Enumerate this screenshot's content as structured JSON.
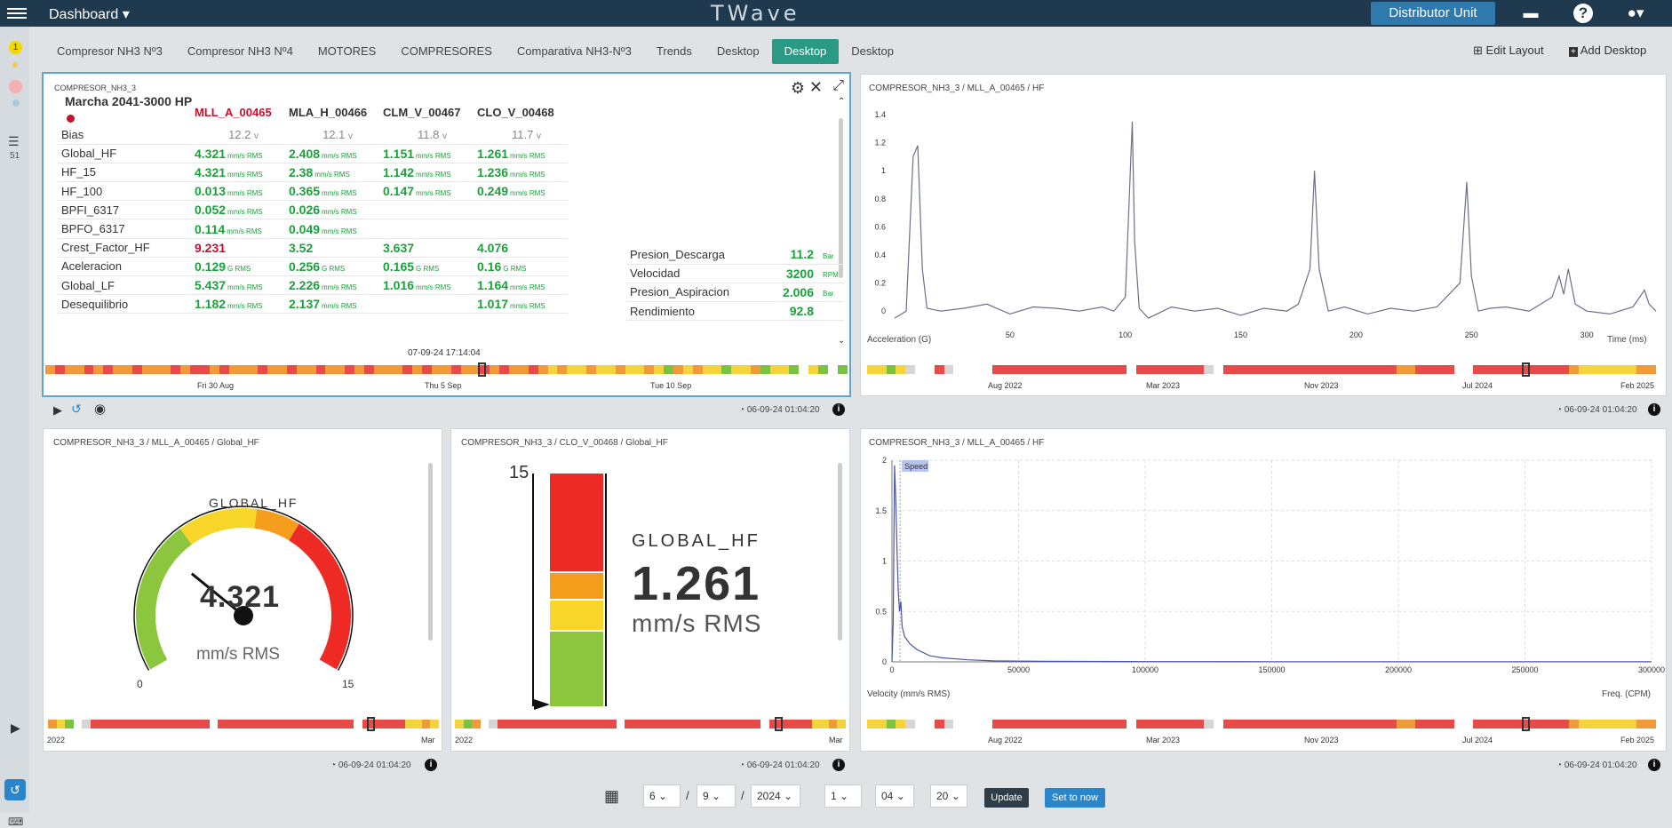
{
  "topbar": {
    "menu": "Dashboard",
    "logo": "TWave",
    "distributor": "Distributor Unit",
    "icons": [
      "chat-icon",
      "help-icon",
      "user-icon"
    ]
  },
  "rail": {
    "badge": "1",
    "count": "51"
  },
  "tabs": [
    {
      "label": "Compresor NH3 Nº3",
      "active": false
    },
    {
      "label": "Compresor NH3 Nº4",
      "active": false
    },
    {
      "label": "MOTORES",
      "active": false
    },
    {
      "label": "COMPRESORES",
      "active": false
    },
    {
      "label": "Comparativa NH3-Nº3",
      "active": false
    },
    {
      "label": "Trends",
      "active": false
    },
    {
      "label": "Desktop",
      "active": false
    },
    {
      "label": "Desktop",
      "active": true
    },
    {
      "label": "Desktop",
      "active": false
    }
  ],
  "actions": {
    "edit_layout": "Edit Layout",
    "add_desktop": "Add Desktop"
  },
  "table_panel": {
    "title": "COMPRESOR_NH3_3",
    "machine": "Marcha 2041-3000 HP",
    "columns": [
      "MLL_A_00465",
      "MLA_H_00466",
      "CLM_V_00467",
      "CLO_V_00468"
    ],
    "bias": {
      "label": "Bias",
      "values": [
        "12.2",
        "12.1",
        "11.8",
        "11.7"
      ],
      "unit": "v"
    },
    "rows": [
      {
        "label": "Global_HF",
        "cells": [
          [
            "4.321",
            "mm/s RMS"
          ],
          [
            "2.408",
            "mm/s RMS"
          ],
          [
            "1.151",
            "mm/s RMS"
          ],
          [
            "1.261",
            "mm/s RMS"
          ]
        ]
      },
      {
        "label": "HF_15",
        "cells": [
          [
            "4.321",
            "mm/s RMS"
          ],
          [
            "2.38",
            "mm/s RMS"
          ],
          [
            "1.142",
            "mm/s RMS"
          ],
          [
            "1.236",
            "mm/s RMS"
          ]
        ]
      },
      {
        "label": "HF_100",
        "cells": [
          [
            "0.013",
            "mm/s RMS"
          ],
          [
            "0.365",
            "mm/s RMS"
          ],
          [
            "0.147",
            "mm/s RMS"
          ],
          [
            "0.249",
            "mm/s RMS"
          ]
        ]
      },
      {
        "label": "BPFI_6317",
        "cells": [
          [
            "0.052",
            "mm/s RMS"
          ],
          [
            "0.026",
            "mm/s RMS"
          ],
          [
            "",
            ""
          ],
          [
            "",
            ""
          ]
        ]
      },
      {
        "label": "BPFO_6317",
        "cells": [
          [
            "0.114",
            "mm/s RMS"
          ],
          [
            "0.049",
            "mm/s RMS"
          ],
          [
            "",
            ""
          ],
          [
            "",
            ""
          ]
        ]
      },
      {
        "label": "Crest_Factor_HF",
        "cells": [
          [
            "9.231",
            ""
          ],
          [
            "3.52",
            ""
          ],
          [
            "3.637",
            ""
          ],
          [
            "4.076",
            ""
          ]
        ]
      },
      {
        "label": "Aceleracion",
        "cells": [
          [
            "0.129",
            "G RMS"
          ],
          [
            "0.256",
            "G RMS"
          ],
          [
            "0.165",
            "G RMS"
          ],
          [
            "0.16",
            "G RMS"
          ]
        ]
      },
      {
        "label": "Global_LF",
        "cells": [
          [
            "5.437",
            "mm/s RMS"
          ],
          [
            "2.226",
            "mm/s RMS"
          ],
          [
            "1.016",
            "mm/s RMS"
          ],
          [
            "1.164",
            "mm/s RMS"
          ]
        ]
      },
      {
        "label": "Desequilibrio",
        "cells": [
          [
            "1.182",
            "mm/s RMS"
          ],
          [
            "2.137",
            "mm/s RMS"
          ],
          [
            "",
            ""
          ],
          [
            "1.017",
            "mm/s RMS"
          ]
        ]
      }
    ],
    "process": [
      {
        "label": "Presion_Descarga",
        "value": "11.2",
        "unit": "Bar"
      },
      {
        "label": "Velocidad",
        "value": "3200",
        "unit": "RPM"
      },
      {
        "label": "Presion_Aspiracion",
        "value": "2.006",
        "unit": "Bar"
      },
      {
        "label": "Rendimiento",
        "value": "92.8",
        "unit": ""
      }
    ],
    "tooltip": "07-09-24 17:14:04",
    "timeline_labels": [
      "Fri 30 Aug",
      "Thu 5 Sep",
      "Tue 10 Sep"
    ],
    "footer": "06-09-24 01:04:20"
  },
  "wave_panel": {
    "title": "COMPRESOR_NH3_3 / MLL_A_00465 / HF",
    "xlabel": "Time (ms)",
    "ylabel": "Acceleration (G)",
    "timeline_labels": [
      "Aug 2022",
      "Mar 2023",
      "Nov 2023",
      "Jul 2024",
      "Feb 2025"
    ],
    "footer": "06-09-24 01:04:20"
  },
  "gauge_panel": {
    "title": "COMPRESOR_NH3_3 / MLL_A_00465 / Global_HF",
    "label": "GLOBAL_HF",
    "value": "4.321",
    "unit": "mm/s RMS",
    "min": "0",
    "max": "15",
    "value_num": 4.321,
    "timeline_labels": [
      "2022",
      "Mar"
    ],
    "footer": "06-09-24 01:04:20"
  },
  "bar_panel": {
    "title": "COMPRESOR_NH3_3 / CLO_V_00468 / Global_HF",
    "label": "GLOBAL_HF",
    "value": "1.261",
    "unit": "mm/s RMS",
    "max": "15",
    "timeline_labels": [
      "2022",
      "Mar"
    ],
    "footer": "06-09-24 01:04:20"
  },
  "spectrum_panel": {
    "title": "COMPRESOR_NH3_3 / MLL_A_00465 / HF",
    "xlabel": "Freq. (CPM)",
    "ylabel": "Velocity (mm/s RMS)",
    "marker": "Speed",
    "timeline_labels": [
      "Aug 2022",
      "Mar 2023",
      "Nov 2023",
      "Jul 2024",
      "Feb 2025"
    ],
    "footer": "06-09-24 01:04:20"
  },
  "bottom": {
    "day": "6",
    "month": "9",
    "year": "2024",
    "hour": "1",
    "minute": "04",
    "second": "20",
    "update": "Update",
    "set_now": "Set to now"
  },
  "colors": {
    "topbar": "#1f3a4f",
    "accent": "#2a9a84",
    "ok": "#1aa33a",
    "alarm": "#c8102e"
  },
  "chart_data": [
    {
      "type": "line",
      "title": "COMPRESOR_NH3_3 / MLL_A_00465 / HF",
      "xlabel": "Time (ms)",
      "ylabel": "Acceleration (G)",
      "xlim": [
        0,
        330
      ],
      "ylim": [
        -0.1,
        1.4
      ],
      "xticks": [
        50,
        100,
        150,
        200,
        250,
        300
      ],
      "yticks": [
        0,
        0.2,
        0.4,
        0.6,
        0.8,
        1,
        1.2,
        1.4
      ],
      "x": [
        0,
        5,
        8,
        10,
        12,
        14,
        20,
        30,
        40,
        50,
        60,
        70,
        80,
        90,
        95,
        100,
        103,
        104,
        106,
        110,
        120,
        130,
        140,
        150,
        160,
        170,
        175,
        180,
        182,
        184,
        188,
        195,
        205,
        215,
        225,
        235,
        245,
        248,
        250,
        253,
        258,
        265,
        275,
        285,
        288,
        290,
        292,
        295,
        300,
        310,
        320,
        325,
        327,
        330
      ],
      "y": [
        -0.05,
        0,
        1.1,
        1.18,
        0.3,
        0.02,
        0,
        0.02,
        0.05,
        -0.02,
        0.03,
        0.02,
        0.0,
        0.03,
        0.0,
        0.1,
        1.35,
        0.5,
        0.02,
        -0.05,
        0.03,
        0.0,
        0.02,
        -0.03,
        0.02,
        0.0,
        0.05,
        0.3,
        1.0,
        0.3,
        0.0,
        0.03,
        -0.02,
        0.02,
        0.0,
        0.03,
        0.2,
        0.92,
        0.25,
        0.0,
        0.02,
        0.03,
        0.0,
        0.1,
        0.25,
        0.12,
        0.3,
        0.05,
        0.0,
        -0.02,
        0.03,
        0.15,
        0.05,
        0.0
      ]
    },
    {
      "type": "line",
      "title": "COMPRESOR_NH3_3 / MLL_A_00465 / HF",
      "xlabel": "Freq. (CPM)",
      "ylabel": "Velocity (mm/s RMS)",
      "xlim": [
        0,
        300000
      ],
      "ylim": [
        0,
        2
      ],
      "xticks": [
        0,
        50000,
        100000,
        150000,
        200000,
        250000,
        300000
      ],
      "yticks": [
        0,
        0.5,
        1,
        1.5,
        2
      ],
      "x": [
        0,
        500,
        1000,
        1500,
        2000,
        2500,
        3000,
        3500,
        4000,
        5000,
        7000,
        10000,
        15000,
        20000,
        30000,
        40000,
        60000,
        100000,
        150000,
        200000,
        250000,
        300000
      ],
      "y": [
        0,
        0.4,
        1.95,
        1.6,
        1.1,
        0.7,
        0.5,
        0.6,
        0.35,
        0.25,
        0.18,
        0.12,
        0.06,
        0.04,
        0.02,
        0.01,
        0.005,
        0.003,
        0.002,
        0.001,
        0.001,
        0.001
      ]
    }
  ]
}
